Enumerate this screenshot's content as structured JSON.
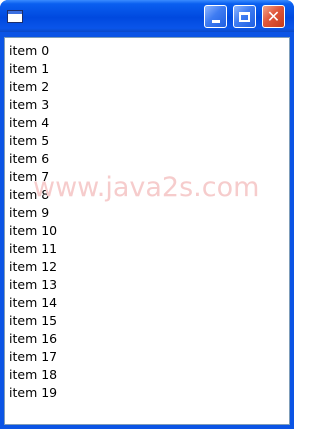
{
  "window": {
    "title": ""
  },
  "titlebar_buttons": {
    "minimize_icon": "minimize-icon",
    "maximize_icon": "maximize-icon",
    "close_icon": "close-icon",
    "close_glyph": "✕"
  },
  "list": {
    "items": [
      "item 0",
      "item 1",
      "item 2",
      "item 3",
      "item 4",
      "item 5",
      "item 6",
      "item 7",
      "item 8",
      "item 9",
      "item 10",
      "item 11",
      "item 12",
      "item 13",
      "item 14",
      "item 15",
      "item 16",
      "item 17",
      "item 18",
      "item 19"
    ]
  },
  "watermark": "www.java2s.com",
  "colors": {
    "titlebar": "#0054e3",
    "close_button": "#e0563a",
    "frame": "#0b54e5"
  }
}
